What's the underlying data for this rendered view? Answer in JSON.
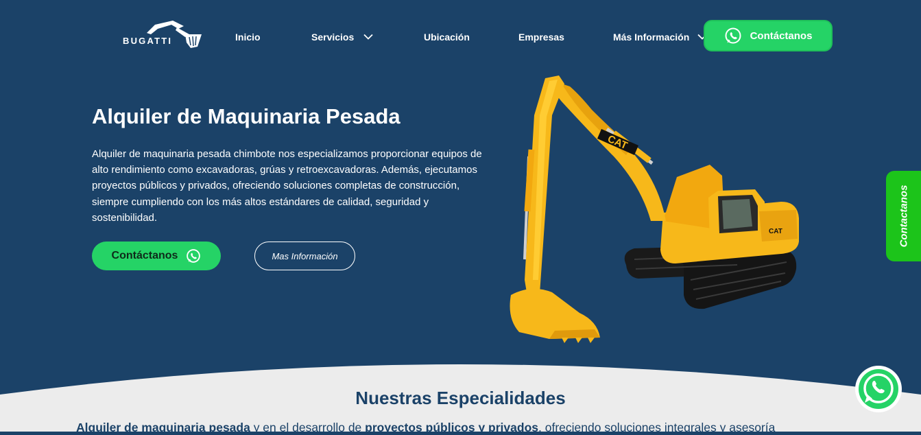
{
  "brand": {
    "name": "BUGATTI",
    "logo_icon": "excavator-arm-logo"
  },
  "nav": {
    "items": [
      {
        "label": "Inicio",
        "has_dropdown": false
      },
      {
        "label": "Servicios",
        "has_dropdown": true
      },
      {
        "label": "Ubicación",
        "has_dropdown": false
      },
      {
        "label": "Empresas",
        "has_dropdown": false
      },
      {
        "label": "Más Información",
        "has_dropdown": true
      }
    ],
    "cta_label": "Contáctanos",
    "cta_icon": "whatsapp-icon"
  },
  "hero": {
    "title": "Alquiler de Maquinaria Pesada",
    "description": "Alquiler de maquinaria pesada chimbote nos especializamos proporcionar equipos de alto rendimiento como excavadoras, grúas y retroexcavadoras. Además, ejecutamos proyectos públicos y privados, ofreciendo soluciones completas de construcción, siempre cumpliendo con los más altos estándares de calidad, seguridad y sostenibilidad.",
    "primary_button": "Contáctanos",
    "secondary_button": "Mas Información",
    "image_brand": "CAT"
  },
  "side_tab": {
    "label": "Contactanos"
  },
  "specialties": {
    "title": "Nuestras Especialidades",
    "text_parts": [
      "Alquiler de maquinaria pesada",
      " y en el desarrollo de ",
      "proyectos públicos y privados",
      ", ofreciendo soluciones integrales y asesoría"
    ]
  },
  "colors": {
    "background": "#1b4268",
    "accent_green": "#25d366",
    "side_tab_green": "#1cc41a",
    "section_bg": "#ececec",
    "excavator_yellow": "#f7b81a"
  }
}
